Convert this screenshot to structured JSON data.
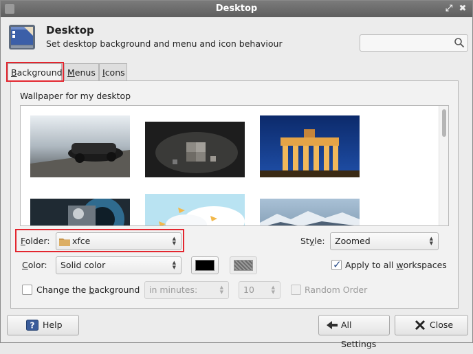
{
  "window": {
    "title": "Desktop"
  },
  "header": {
    "title": "Desktop",
    "subtitle": "Set desktop background and menu and icon behaviour",
    "search_placeholder": ""
  },
  "tabs": [
    {
      "label": "ackground",
      "mnemonic": "B",
      "active": true
    },
    {
      "label": "enus",
      "mnemonic": "M",
      "active": false
    },
    {
      "label": "cons",
      "mnemonic": "I",
      "active": false
    }
  ],
  "background": {
    "section_title": "Wallpaper for my desktop",
    "folder": {
      "label": "older:",
      "mnemonic": "F",
      "value": "xfce"
    },
    "style": {
      "label": "St",
      "mnemonic": "y",
      "label_rest": "le:",
      "value": "Zoomed"
    },
    "color": {
      "label": "olor:",
      "mnemonic": "C",
      "value": "Solid color",
      "primary": "#000000",
      "secondary": "#7a7a7a"
    },
    "apply_all": {
      "label_pre": "Apply to all ",
      "mnemonic": "w",
      "label_post": "orkspaces",
      "checked": true
    },
    "change_bg": {
      "label_pre": "Change the ",
      "mnemonic": "b",
      "label_post": "ackground",
      "checked": false
    },
    "interval_unit": "in minutes:",
    "interval_value": "10",
    "random_order": {
      "label": "Random Order",
      "checked": false
    }
  },
  "wallpapers": [
    {
      "name": "wallpaper-lamborghini"
    },
    {
      "name": "wallpaper-dice"
    },
    {
      "name": "wallpaper-brandenburg-gate"
    },
    {
      "name": "wallpaper-motor"
    },
    {
      "name": "wallpaper-clouds"
    },
    {
      "name": "wallpaper-mountains"
    }
  ],
  "footer": {
    "help_label": "Help",
    "all_settings_label": "All Settings",
    "close_label": "Close"
  },
  "colors": {
    "highlight": "#e3262f",
    "titlebar": "#6a6a6a"
  }
}
